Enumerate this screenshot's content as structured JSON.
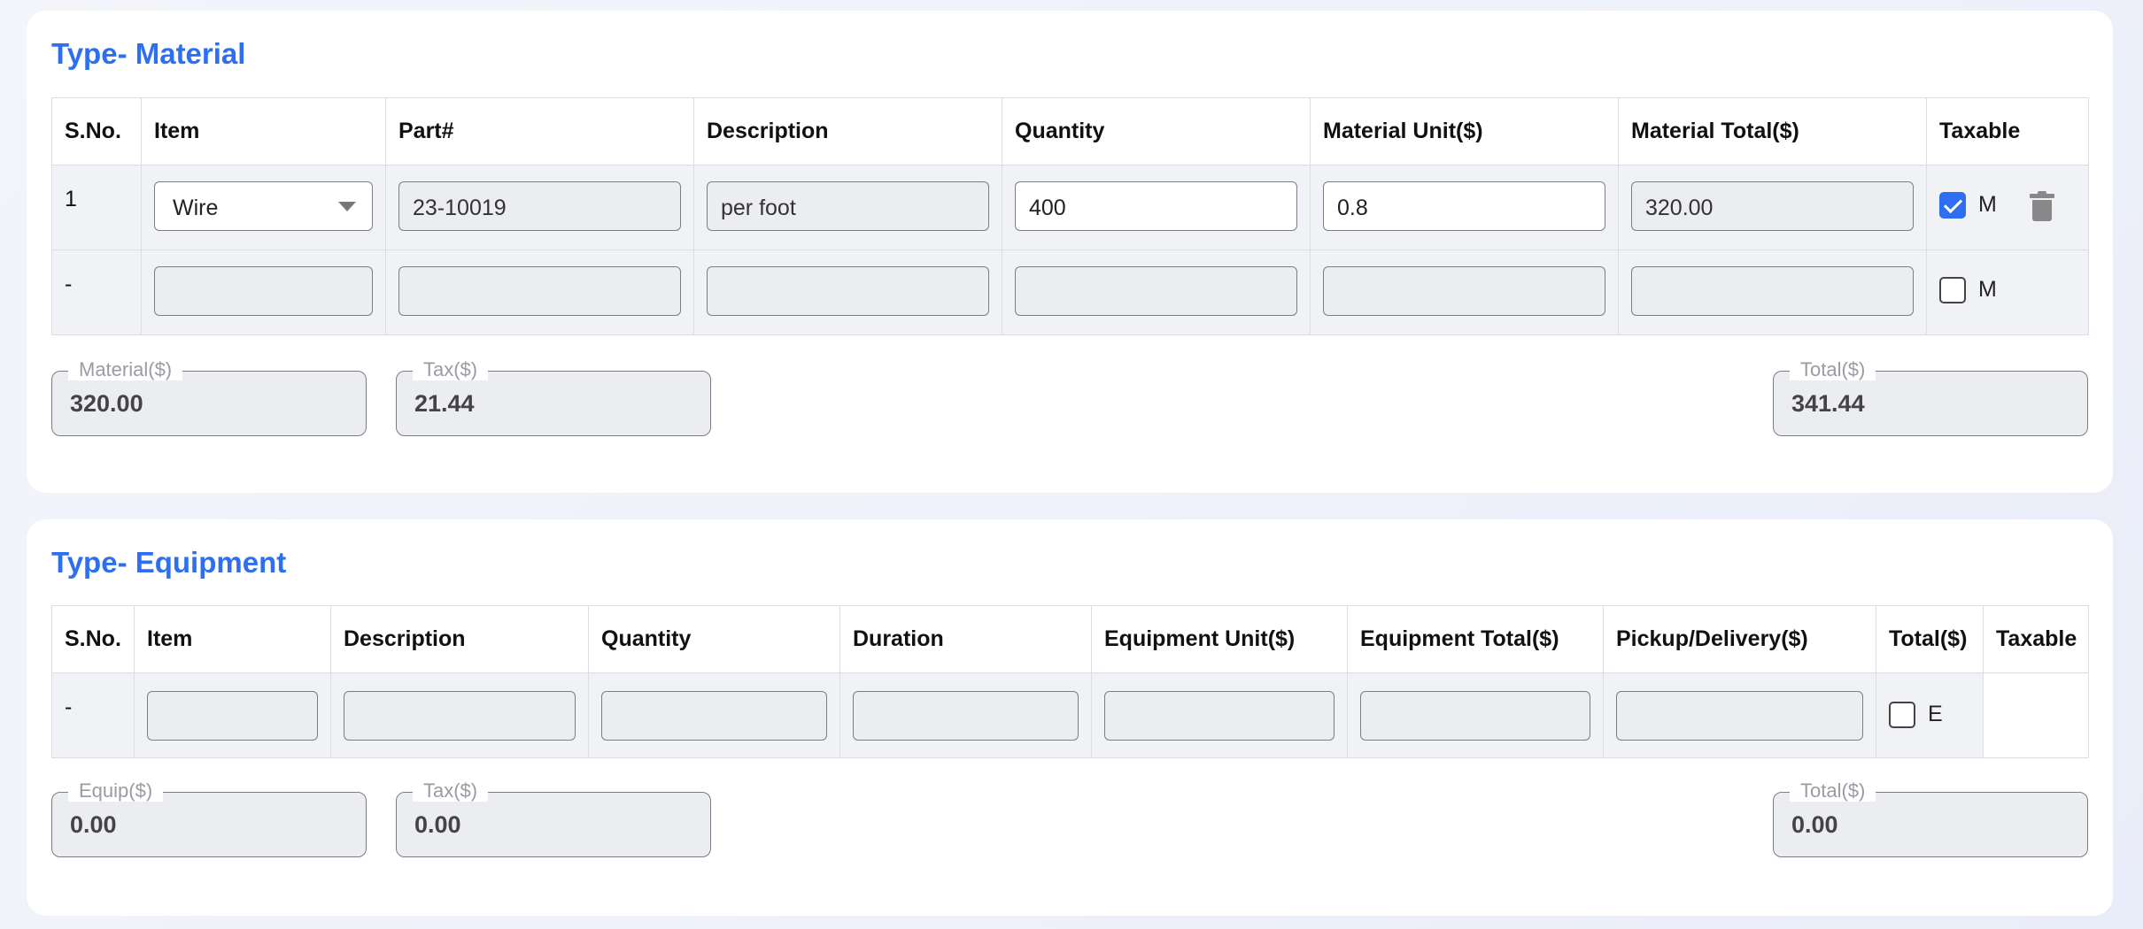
{
  "material": {
    "title": "Type- Material",
    "headers": [
      "S.No.",
      "Item",
      "Part#",
      "Description",
      "Quantity",
      "Material Unit($)",
      "Material Total($)",
      "Taxable"
    ],
    "rows": [
      {
        "sno": "1",
        "item": "Wire",
        "part": "23-10019",
        "description": "per foot",
        "quantity": "400",
        "unit": "0.8",
        "total": "320.00",
        "taxable": true,
        "tax_code": "M"
      },
      {
        "sno": "-",
        "item": "",
        "part": "",
        "description": "",
        "quantity": "",
        "unit": "",
        "total": "",
        "taxable": false,
        "tax_code": "M"
      }
    ],
    "summary": {
      "material_label": "Material($)",
      "material_value": "320.00",
      "tax_label": "Tax($)",
      "tax_value": "21.44",
      "total_label": "Total($)",
      "total_value": "341.44"
    }
  },
  "equipment": {
    "title": "Type- Equipment",
    "headers": [
      "S.No.",
      "Item",
      "Description",
      "Quantity",
      "Duration",
      "Equipment Unit($)",
      "Equipment Total($)",
      "Pickup/Delivery($)",
      "Total($)",
      "Taxable"
    ],
    "rows": [
      {
        "sno": "-",
        "item": "",
        "description": "",
        "quantity": "",
        "duration": "",
        "unit": "",
        "total": "",
        "pickup": "",
        "taxable": false,
        "tax_code": "E"
      }
    ],
    "summary": {
      "equip_label": "Equip($)",
      "equip_value": "0.00",
      "tax_label": "Tax($)",
      "tax_value": "0.00",
      "total_label": "Total($)",
      "total_value": "0.00"
    }
  },
  "colors": {
    "accent": "#2d6ff0",
    "field_bg": "#ecedf1",
    "row_bg": "#f1f2f6"
  },
  "icons": {
    "delete": "trash-icon",
    "dropdown": "chevron-down-icon",
    "checkbox": "checkbox-icon"
  }
}
